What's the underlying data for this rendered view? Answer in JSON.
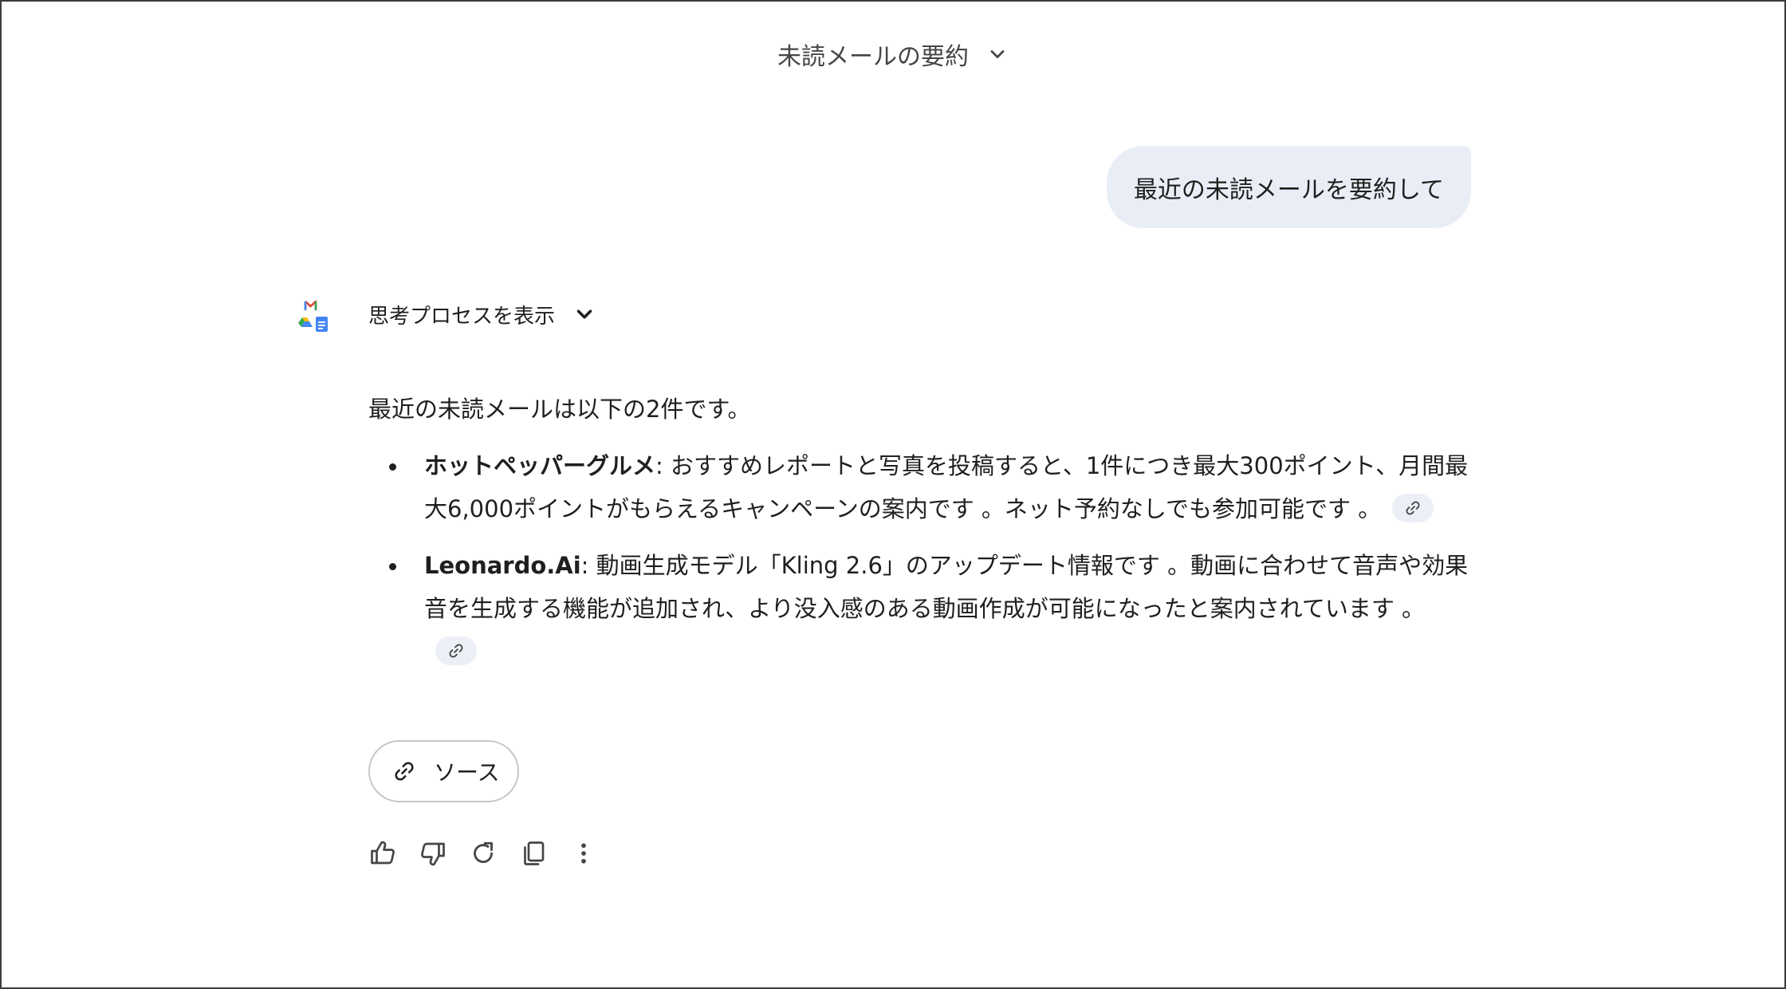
{
  "header": {
    "conversation_title": "未読メールの要約"
  },
  "user_message": {
    "text": "最近の未読メールを要約して"
  },
  "response": {
    "thinking_toggle_label": "思考プロセスを表示",
    "intro": "最近の未読メールは以下の2件です。",
    "items": [
      {
        "sender": "ホットペッパーグルメ",
        "body": ": おすすめレポートと写真を投稿すると、1件につき最大300ポイント、月間最大6,000ポイントがもらえるキャンペーンの案内です 。ネット予約なしでも参加可能です 。"
      },
      {
        "sender": "Leonardo.Ai",
        "body": ": 動画生成モデル「Kling 2.6」のアップデート情報です 。動画に合わせて音声や効果音を生成する機能が追加され、より没入感のある動画作成が可能になったと案内されています 。"
      }
    ],
    "sources_button_label": "ソース"
  },
  "icons": {
    "model_avatar": "gmail-drive-docs-icon",
    "title_chevron": "chevron-down-icon",
    "thinking_chevron": "chevron-down-icon",
    "citation": "link-icon",
    "actions": [
      "thumbs-up-icon",
      "thumbs-down-icon",
      "redo-icon",
      "copy-icon",
      "more-vert-icon"
    ]
  },
  "colors": {
    "user_bubble_bg": "#e9eef6",
    "text_primary": "#1f1f1f",
    "text_secondary": "#444746",
    "chip_bg": "#eceff5",
    "outline": "#c4c7c5"
  }
}
